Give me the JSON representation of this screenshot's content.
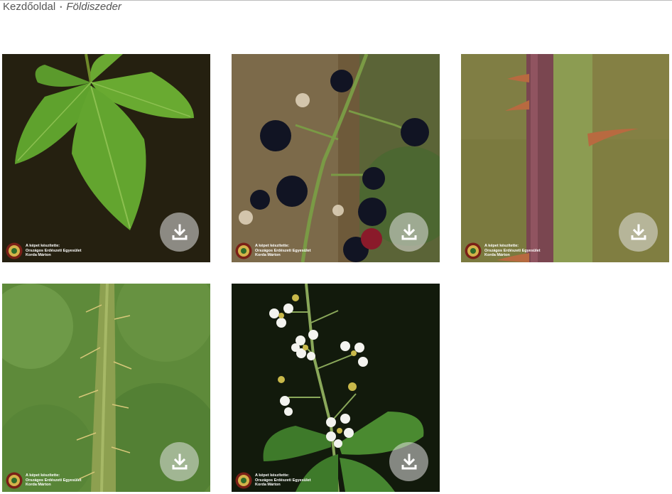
{
  "breadcrumb": {
    "home": "Kezdőoldal",
    "separator": "•",
    "current": "Földiszeder"
  },
  "gallery": {
    "download_icon": "download-icon",
    "credit": {
      "line1": "A képet készítette:",
      "line2": "Országos Erdészeti Egyesület",
      "line3": "Korda Márton"
    },
    "photos": [
      {
        "subject": "leaf"
      },
      {
        "subject": "berries"
      },
      {
        "subject": "stem-with-thorns"
      },
      {
        "subject": "hairy-stem"
      },
      {
        "subject": "flowers"
      }
    ]
  }
}
